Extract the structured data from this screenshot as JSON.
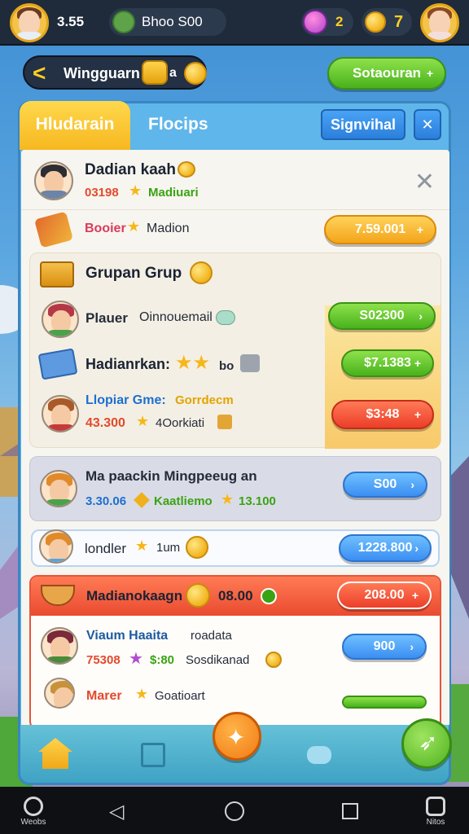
{
  "topbar": {
    "score": "3.55",
    "player_label": "Bhoo S00",
    "gems": "2",
    "coins": "7"
  },
  "header": {
    "back_label": "Wingguarn",
    "back_suffix": "a",
    "action_label": "Sotaouran",
    "action_icon": "+"
  },
  "tabs": {
    "active": "Hludarain",
    "second": "Flocips",
    "search_button": "Signvihal",
    "close": "✕"
  },
  "list": {
    "profile": {
      "name": "Dadian kaah",
      "stat": "03198",
      "stat2": "Madiuari",
      "close": "✕"
    },
    "booster": {
      "label1": "Booier",
      "label2": "Madion",
      "price": "7.59.001",
      "plus": "+"
    },
    "group": {
      "title": "Grupan Grup",
      "items": [
        {
          "name": "Plauer",
          "detail": "Oinnouemail",
          "price": "S02300",
          "plus": "›"
        },
        {
          "name": "Hadianrkan:",
          "detail": "bo",
          "price": "$7.1383",
          "plus": "+"
        },
        {
          "name": "Llopiar Gme:",
          "detail": "Gorrdecm",
          "stat": "43.300",
          "stat2": "4Oorkiati",
          "price": "$3:48",
          "plus": "+"
        }
      ]
    },
    "mission": {
      "title": "Ma paackin Mingpeeug an",
      "stat": "3.30.06",
      "stat2": "Kaatliemo",
      "stat3": "13.100",
      "price": "S00",
      "plus": "›"
    },
    "single": {
      "name": "londler",
      "detail": "1um",
      "price": "1228.800",
      "plus": "›"
    },
    "event": {
      "title": "Madianokaagn",
      "amount": "08.00",
      "price": "208.00",
      "plus": "+",
      "items": [
        {
          "name": "Viaum Haaita",
          "detail": "roadata",
          "stat": "75308",
          "stat2": "$:80",
          "stat3": "Sosdikanad",
          "price": "900",
          "plus": "›"
        },
        {
          "name": "Marer",
          "detail": "Goatioart"
        }
      ]
    }
  },
  "system_nav": {
    "left_label": "Weobs",
    "right_label": "Nitos"
  },
  "colors": {
    "accent_green": "#48b21c",
    "accent_orange": "#f3a51a",
    "accent_red": "#ec3e2a",
    "accent_blue": "#3b8ef2",
    "panel_blue": "#5fb6ea"
  }
}
